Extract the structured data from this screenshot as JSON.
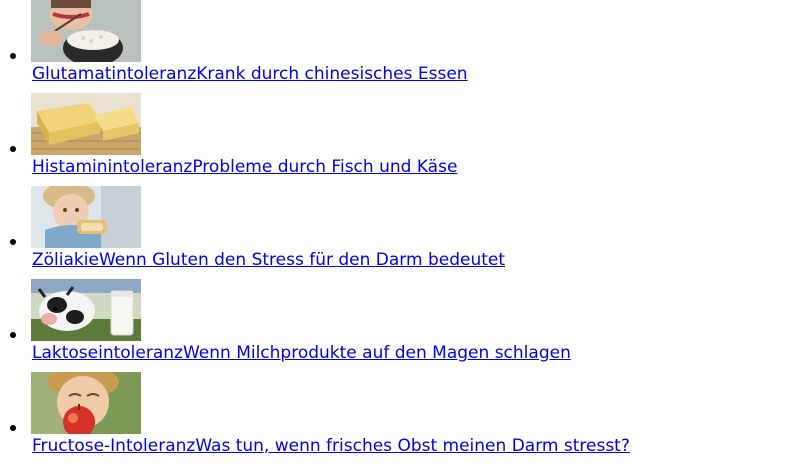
{
  "articles": [
    {
      "title": "Glutamatintoleranz",
      "subtitle": "Krank durch chinesisches Essen",
      "image": "woman-eating-rice-bowl-thumbnail"
    },
    {
      "title": "Histaminintoleranz",
      "subtitle": "Probleme durch Fisch und Käse",
      "image": "cheese-block-thumbnail"
    },
    {
      "title": "Zöliakie",
      "subtitle": "Wenn Gluten den Stress für den Darm bedeutet",
      "image": "child-eating-bread-thumbnail"
    },
    {
      "title": "Laktoseintoleranz",
      "subtitle": "Wenn Milchprodukte auf den Magen schlagen",
      "image": "cow-and-milk-glass-thumbnail"
    },
    {
      "title": "Fructose-Intoleranz",
      "subtitle": "Was tun, wenn frisches Obst meinen Darm stresst?",
      "image": "woman-biting-apple-thumbnail"
    }
  ],
  "colors": {
    "link": "#0000ee",
    "background": "#ffffff"
  }
}
